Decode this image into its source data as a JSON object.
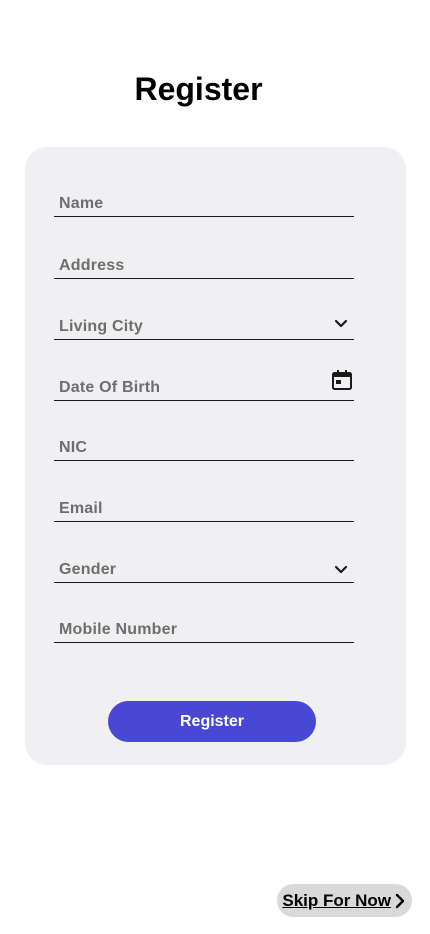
{
  "page": {
    "title": "Register"
  },
  "form": {
    "fields": [
      {
        "label": "Name"
      },
      {
        "label": "Address"
      },
      {
        "label": "Living City",
        "icon": "chevron-down-icon"
      },
      {
        "label": "Date Of Birth",
        "icon": "calendar-icon"
      },
      {
        "label": "NIC"
      },
      {
        "label": "Email"
      },
      {
        "label": "Gender",
        "icon": "chevron-down-icon"
      },
      {
        "label": "Mobile Number"
      }
    ],
    "submit_label": "Register"
  },
  "footer": {
    "skip_label": "Skip For Now",
    "skip_icon": "chevron-right-icon"
  },
  "colors": {
    "card_background": "#f0f0f2",
    "primary_button": "#4848d4",
    "skip_button": "#d9d9d9",
    "placeholder_text": "#6e6e6e"
  }
}
